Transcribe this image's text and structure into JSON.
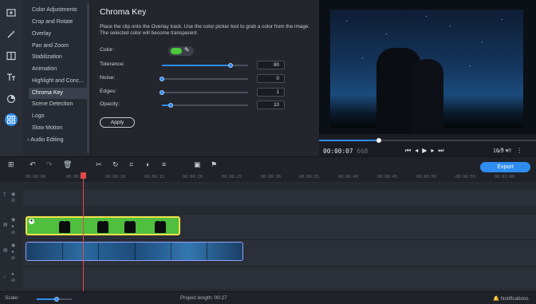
{
  "rail": {
    "icons": [
      "import-icon",
      "magic-wand-icon",
      "transitions-icon",
      "titles-icon",
      "stickers-icon",
      "more-tools-icon"
    ]
  },
  "menu": {
    "items": [
      "Color Adjustments",
      "Crop and Rotate",
      "Overlay",
      "Pan and Zoom",
      "Stabilization",
      "Animation",
      "Highlight and Conc...",
      "Chroma Key",
      "Scene Detection",
      "Logo",
      "Slow Motion",
      "Audio Editing"
    ],
    "selected_index": 7
  },
  "panel": {
    "title": "Chroma Key",
    "description": "Place the clip onto the Overlay track. Use the color picker tool to grab a color from the image. The selected color will become transparent.",
    "color_label": "Color:",
    "key_color": "#4cc93a",
    "params": [
      {
        "label": "Tolerance:",
        "value": "80",
        "level": 0.8
      },
      {
        "label": "Noise:",
        "value": "0",
        "level": 0.0
      },
      {
        "label": "Edges:",
        "value": "1",
        "level": 0.0
      },
      {
        "label": "Opacity:",
        "value": "10",
        "level": 0.1
      }
    ],
    "apply_label": "Apply"
  },
  "player": {
    "timecode": "00:00:07",
    "timecode_extra": "668",
    "aspect_ratio": "16:9",
    "progress": 0.27
  },
  "toolbar": {
    "export_label": "Export"
  },
  "timeline": {
    "ticks": [
      "00:00:00",
      "00:00:05",
      "00:00:10",
      "00:00:15",
      "00:00:20",
      "00:00:25",
      "00:00:30",
      "00:00:35",
      "00:00:40",
      "00:00:45",
      "00:00:50",
      "00:00:55",
      "00:01:00"
    ]
  },
  "status": {
    "scale_label": "Scale:",
    "project_length": "Project length:  00:27",
    "notifications": "Notifications"
  },
  "colors": {
    "accent": "#2f8df1",
    "green_clip": "#4fbf3d",
    "playhead": "#e24a4a"
  }
}
